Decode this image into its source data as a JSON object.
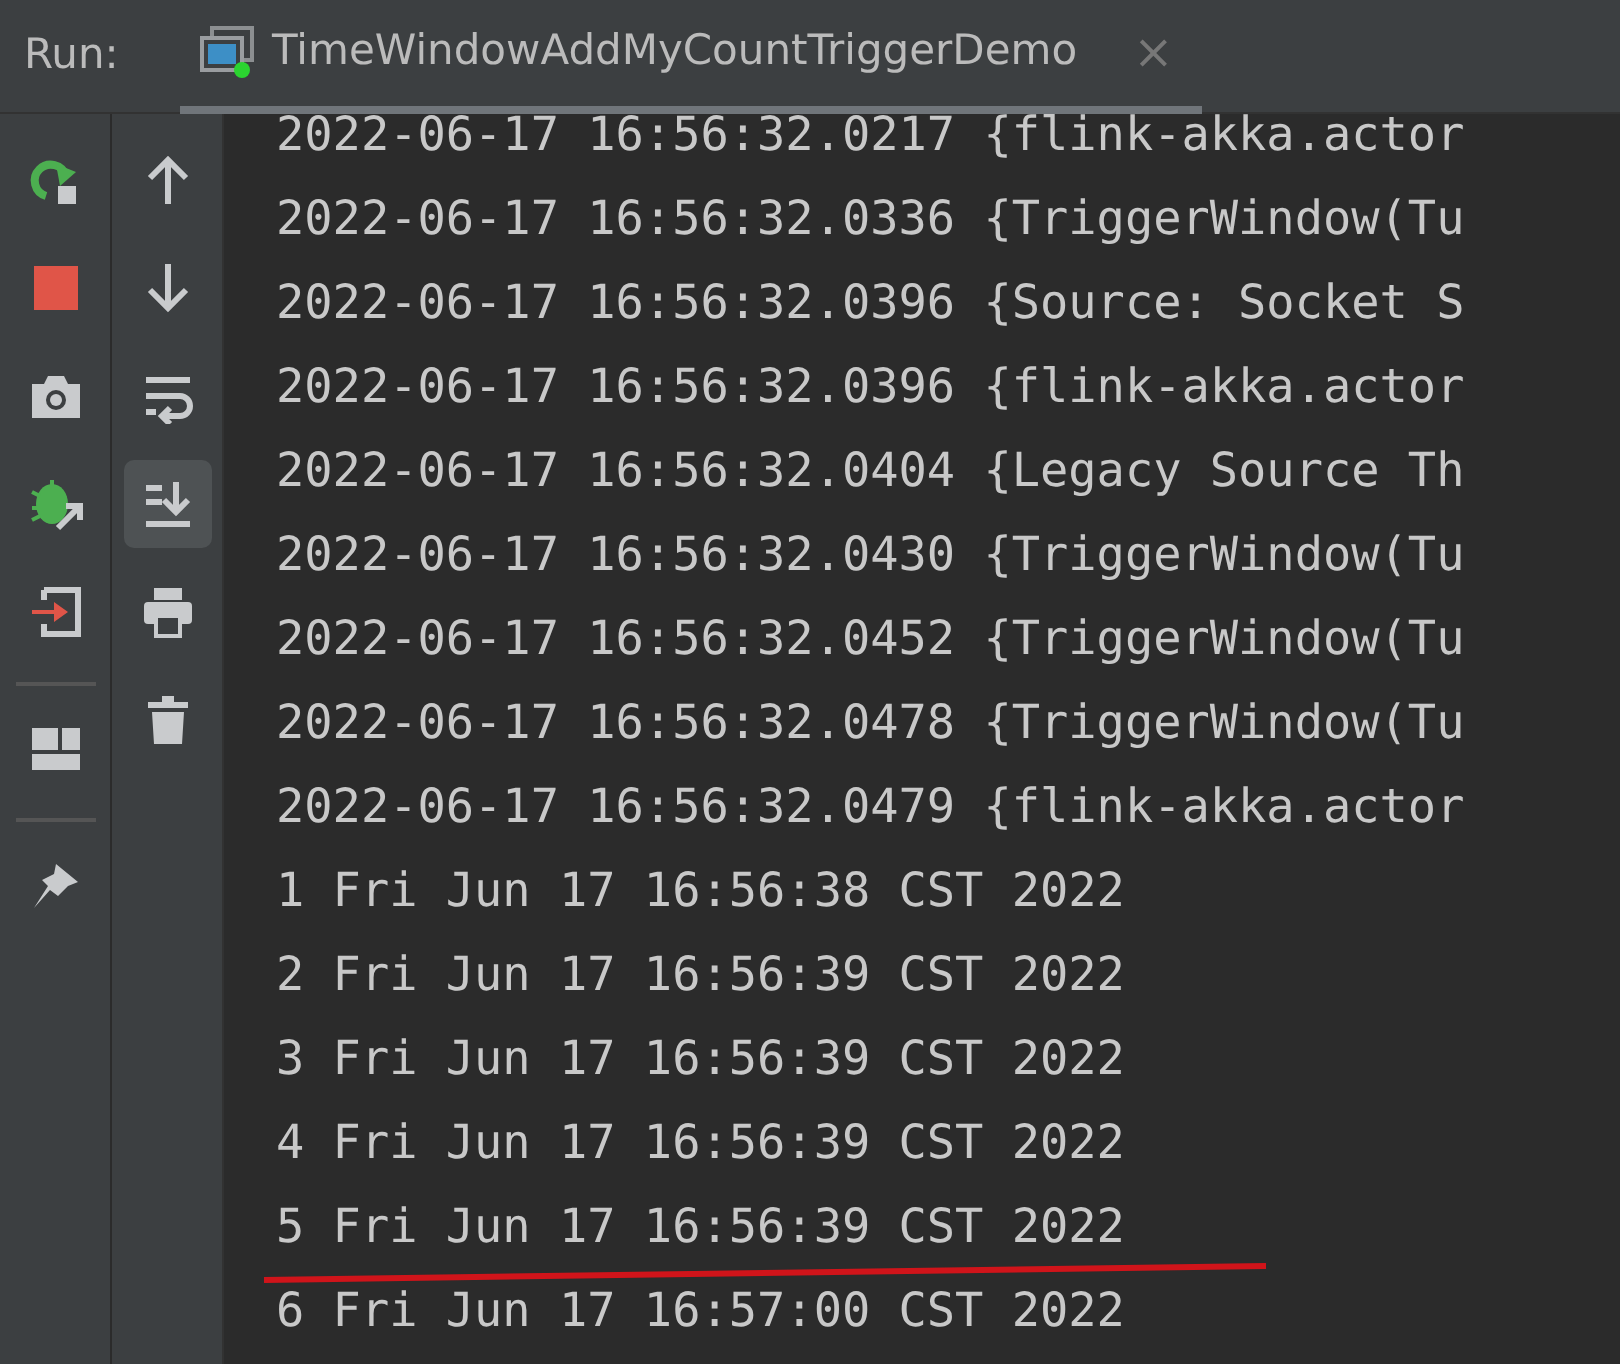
{
  "run_bar": {
    "label": "Run:",
    "tab": {
      "title": "TimeWindowAddMyCountTriggerDemo",
      "selected": true,
      "close": "×"
    }
  },
  "left_toolbar": [
    {
      "kind": "rerun"
    },
    {
      "kind": "stop"
    },
    {
      "kind": "camera"
    },
    {
      "kind": "debug"
    },
    {
      "kind": "exit"
    },
    {
      "kind": "separator"
    },
    {
      "kind": "layout"
    },
    {
      "kind": "separator"
    },
    {
      "kind": "pin"
    }
  ],
  "right_toolbar": [
    {
      "kind": "up",
      "on": false
    },
    {
      "kind": "down",
      "on": false
    },
    {
      "kind": "wrap",
      "on": false
    },
    {
      "kind": "scroll-end",
      "on": true
    },
    {
      "kind": "print",
      "on": false
    },
    {
      "kind": "trash",
      "on": false
    }
  ],
  "console_lines": [
    "2022-06-17 16:56:32.0217 {flink-akka.actor",
    "2022-06-17 16:56:32.0336 {TriggerWindow(Tu",
    "2022-06-17 16:56:32.0396 {Source: Socket S",
    "2022-06-17 16:56:32.0396 {flink-akka.actor",
    "2022-06-17 16:56:32.0404 {Legacy Source Th",
    "2022-06-17 16:56:32.0430 {TriggerWindow(Tu",
    "2022-06-17 16:56:32.0452 {TriggerWindow(Tu",
    "2022-06-17 16:56:32.0478 {TriggerWindow(Tu",
    "2022-06-17 16:56:32.0479 {flink-akka.actor",
    "1 Fri Jun 17 16:56:38 CST 2022",
    "2 Fri Jun 17 16:56:39 CST 2022",
    "3 Fri Jun 17 16:56:39 CST 2022",
    "4 Fri Jun 17 16:56:39 CST 2022",
    "5 Fri Jun 17 16:56:39 CST 2022",
    "6 Fri Jun 17 16:57:00 CST 2022"
  ]
}
